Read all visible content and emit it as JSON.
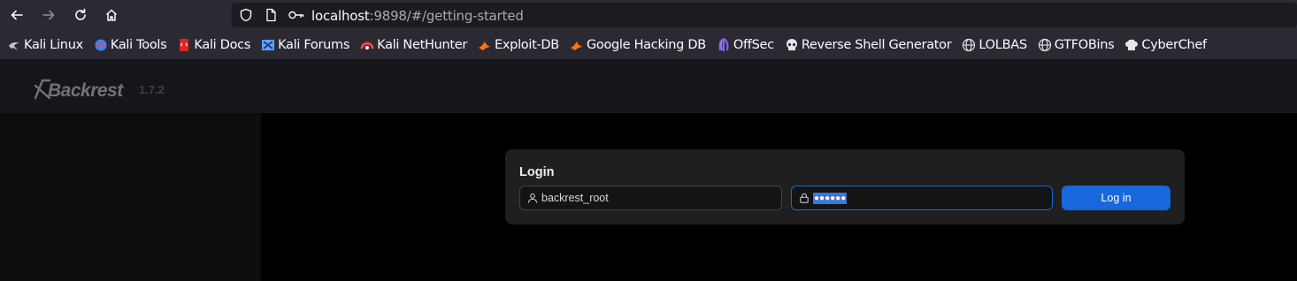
{
  "browser": {
    "url": {
      "host": "localhost",
      "path": ":9898/#/getting-started"
    },
    "bookmarks": [
      {
        "label": "Kali Linux",
        "icon": "kali-dragon-icon",
        "color": "#bfc5cc"
      },
      {
        "label": "Kali Tools",
        "icon": "kali-tools-icon",
        "color": "#3b82f6"
      },
      {
        "label": "Kali Docs",
        "icon": "kali-docs-icon",
        "color": "#dc2626"
      },
      {
        "label": "Kali Forums",
        "icon": "kali-forums-icon",
        "color": "#60a5fa"
      },
      {
        "label": "Kali NetHunter",
        "icon": "nethunter-icon",
        "color": "#ef4444"
      },
      {
        "label": "Exploit-DB",
        "icon": "exploit-db-icon",
        "color": "#f97316"
      },
      {
        "label": "Google Hacking DB",
        "icon": "ghdb-icon",
        "color": "#f97316"
      },
      {
        "label": "OffSec",
        "icon": "offsec-icon",
        "color": "#8b5cf6"
      },
      {
        "label": "Reverse Shell Generator",
        "icon": "skull-icon",
        "color": "#e5e7eb"
      },
      {
        "label": "LOLBAS",
        "icon": "globe-icon",
        "color": "#e5e7eb"
      },
      {
        "label": "GTFOBins",
        "icon": "globe-icon",
        "color": "#e5e7eb"
      },
      {
        "label": "CyberChef",
        "icon": "chef-hat-icon",
        "color": "#e5e7eb"
      }
    ]
  },
  "app": {
    "logo_text": "Backrest",
    "version": "1.7.2"
  },
  "login": {
    "title": "Login",
    "username_value": "backrest_root",
    "password_value": "●●●●●●",
    "button_label": "Log in"
  },
  "colors": {
    "accent": "#1668dc",
    "card_bg": "#1f1f1f",
    "header_bg": "#141619"
  }
}
